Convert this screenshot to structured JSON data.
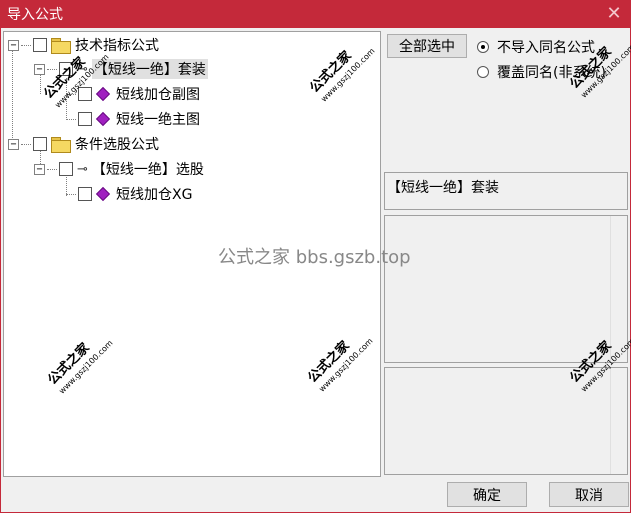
{
  "window": {
    "title": "导入公式",
    "close_glyph": "✕"
  },
  "tree": {
    "groups": [
      {
        "label": "技术指标公式",
        "children": [
          {
            "label": "【短线一绝】套装",
            "children": [
              {
                "label": "短线加仓副图"
              },
              {
                "label": "短线一绝主图"
              }
            ]
          }
        ]
      },
      {
        "label": "条件选股公式",
        "children": [
          {
            "label": "【短线一绝】选股",
            "children": [
              {
                "label": "短线加仓XG"
              }
            ]
          }
        ]
      }
    ]
  },
  "options": {
    "select_all_label": "全部选中",
    "radio_skip_label": "不导入同名公式",
    "radio_overwrite_label": "覆盖同名(非系统)",
    "selected_radio": "skip"
  },
  "detail": {
    "name": "【短线一绝】套装"
  },
  "footer": {
    "ok_label": "确定",
    "cancel_label": "取消"
  },
  "watermarks": {
    "brand": "公式之家",
    "url": "www.gszj100.com",
    "center": "公式之家 bbs.gszb.top"
  }
}
